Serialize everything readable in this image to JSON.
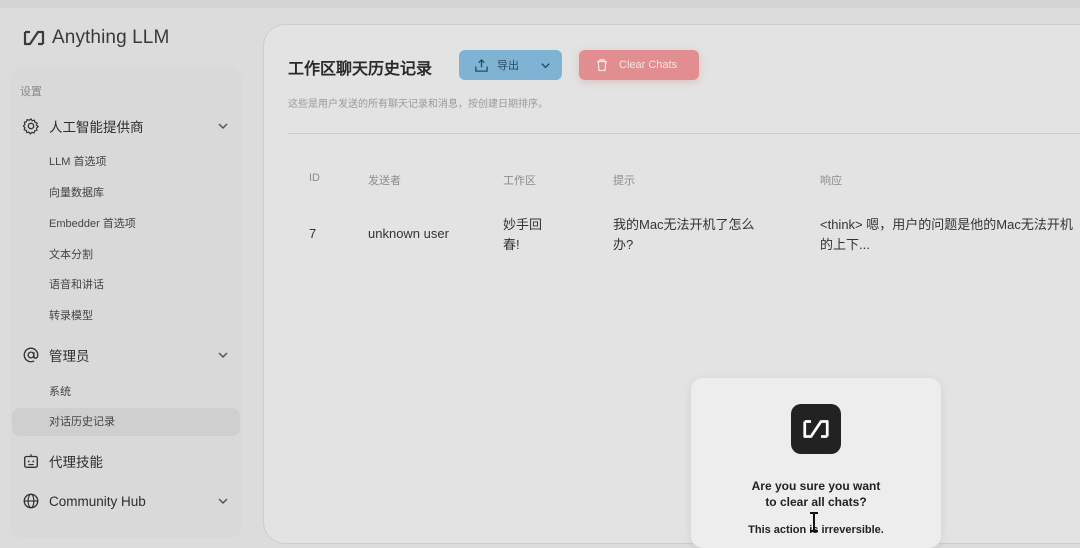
{
  "app": {
    "name": "Anything LLM"
  },
  "sidebar": {
    "section_label": "设置",
    "groups": [
      {
        "label": "人工智能提供商",
        "icon": "gear-icon",
        "items": [
          "LLM 首选项",
          "向量数据库",
          "Embedder 首选项",
          "文本分割",
          "语音和讲话",
          "转录模型"
        ]
      },
      {
        "label": "管理员",
        "icon": "at-sign-icon",
        "items": [
          "系统",
          "对话历史记录"
        ]
      },
      {
        "label": "代理技能",
        "icon": "robot-icon"
      },
      {
        "label": "Community Hub",
        "icon": "globe-icon"
      }
    ],
    "active_item": "对话历史记录"
  },
  "main": {
    "title": "工作区聊天历史记录",
    "export_label": "导出",
    "clear_label": "Clear Chats",
    "description": "这些是用户发送的所有聊天记录和消息，按创建日期排序。",
    "table": {
      "headers": [
        "ID",
        "发送者",
        "工作区",
        "提示",
        "响应"
      ],
      "rows": [
        [
          "7",
          "unknown user",
          "妙手回春!",
          "我的Mac无法开机了怎么办?",
          "<think> 嗯，用户的问题是他的Mac无法开机 的上下..."
        ]
      ]
    }
  },
  "modal": {
    "title_line1": "Are you sure you want",
    "title_line2": "to clear all chats?",
    "body_partial": "This action is irreversible."
  },
  "colors": {
    "export_button": "#7fb3d3",
    "clear_button": "#e28d8f",
    "background": "#dcdcdc"
  }
}
